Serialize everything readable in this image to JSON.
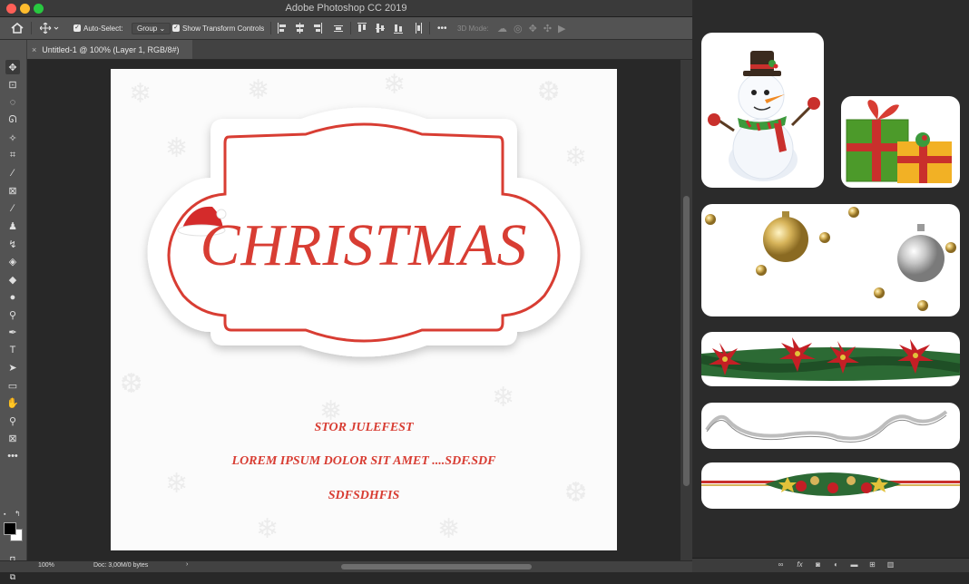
{
  "window": {
    "title": "Adobe Photoshop CC 2019"
  },
  "options_bar": {
    "auto_select_label": "Auto-Select:",
    "auto_select_value": "Group",
    "show_transform_label": "Show Transform Controls",
    "mode_3d_label": "3D Mode:",
    "more_label": "•••"
  },
  "document_tab": {
    "label": "Untitled-1 @ 100% (Layer 1, RGB/8#)",
    "close_glyph": "×"
  },
  "tools": [
    {
      "name": "move-tool",
      "glyph": "✥"
    },
    {
      "name": "artboard-tool",
      "glyph": "⊡"
    },
    {
      "name": "marquee-tool",
      "glyph": "◌"
    },
    {
      "name": "lasso-tool",
      "glyph": "ᘏ"
    },
    {
      "name": "quick-select-tool",
      "glyph": "✧"
    },
    {
      "name": "crop-tool",
      "glyph": "⌗"
    },
    {
      "name": "eyedropper-tool",
      "glyph": "⁄"
    },
    {
      "name": "frame-tool",
      "glyph": "⊠"
    },
    {
      "name": "brush-tool",
      "glyph": "∕"
    },
    {
      "name": "stamp-tool",
      "glyph": "♟"
    },
    {
      "name": "history-brush-tool",
      "glyph": "↯"
    },
    {
      "name": "eraser-tool",
      "glyph": "◈"
    },
    {
      "name": "paint-bucket-tool",
      "glyph": "◆"
    },
    {
      "name": "blur-tool",
      "glyph": "●"
    },
    {
      "name": "dodge-tool",
      "glyph": "⚲"
    },
    {
      "name": "pen-tool",
      "glyph": "✒"
    },
    {
      "name": "type-tool",
      "glyph": "T"
    },
    {
      "name": "path-select-tool",
      "glyph": "➤"
    },
    {
      "name": "rectangle-tool",
      "glyph": "▭"
    },
    {
      "name": "hand-tool",
      "glyph": "✋"
    },
    {
      "name": "zoom-tool",
      "glyph": "⚲"
    },
    {
      "name": "3d-tool",
      "glyph": "⊠"
    },
    {
      "name": "more-tools",
      "glyph": "•••"
    }
  ],
  "status": {
    "zoom": "100%",
    "doc": "Doc: 3,00M/0 bytes",
    "arrow": "›"
  },
  "design": {
    "title": "CHRISTMAS",
    "line1": "STOR JULEFEST",
    "line2": "LOREM IPSUM DOLOR SIT AMET ....SDF.SDF",
    "line3": "SDFSDHFIS"
  },
  "colors": {
    "accent_red": "#d83d33",
    "panel_bg": "#535353",
    "workspace_bg": "#282828"
  },
  "assets": [
    {
      "name": "snowman-card"
    },
    {
      "name": "gift-boxes-card"
    },
    {
      "name": "ornaments-card"
    },
    {
      "name": "poinsettia-garland-card"
    },
    {
      "name": "silver-ribbon-card"
    },
    {
      "name": "pine-ribbon-card"
    }
  ],
  "panel_footer_icons": [
    "link-icon",
    "fx-icon",
    "mask-icon",
    "adjustment-icon",
    "folder-icon",
    "new-layer-icon",
    "trash-icon"
  ]
}
